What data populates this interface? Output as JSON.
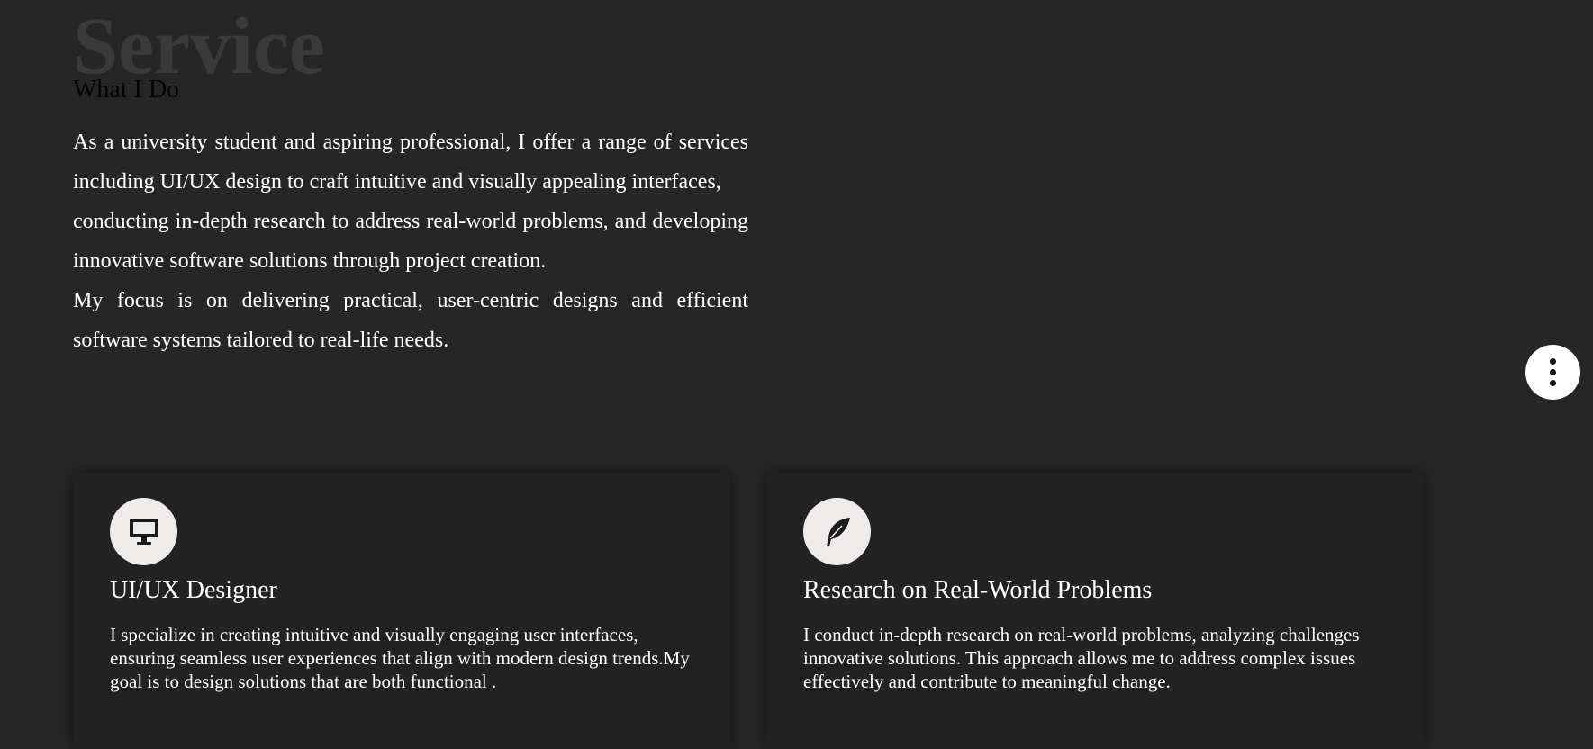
{
  "service": {
    "background_title": "Service",
    "subtitle": "What I Do",
    "intro_paragraphs": [
      "As a university student and aspiring professional, I offer a range of services including UI/UX design to craft intuitive and visually appealing interfaces,",
      "conducting in-depth research to address real-world problems, and developing innovative software solutions through project creation.",
      "My focus is on delivering practical, user-centric designs and efficient software systems tailored to real-life needs."
    ],
    "cards": [
      {
        "icon": "desktop-icon",
        "title": "UI/UX Designer",
        "text": "I specialize in creating intuitive and visually engaging user interfaces, ensuring seamless user experiences that align with modern design trends.My goal is to design solutions that are both functional ."
      },
      {
        "icon": "feather-icon",
        "title": "Research on Real-World Problems",
        "text": "I conduct in-depth research on real-world problems, analyzing challenges innovative solutions. This approach allows me to address complex issues effectively and contribute to meaningful change."
      }
    ]
  },
  "fab": {
    "icon": "vertical-dots-menu-icon"
  },
  "colors": {
    "page_background": "#262626",
    "card_background": "#222222",
    "icon_circle": "#f0ebeb",
    "background_title": "#3a3a3a"
  }
}
